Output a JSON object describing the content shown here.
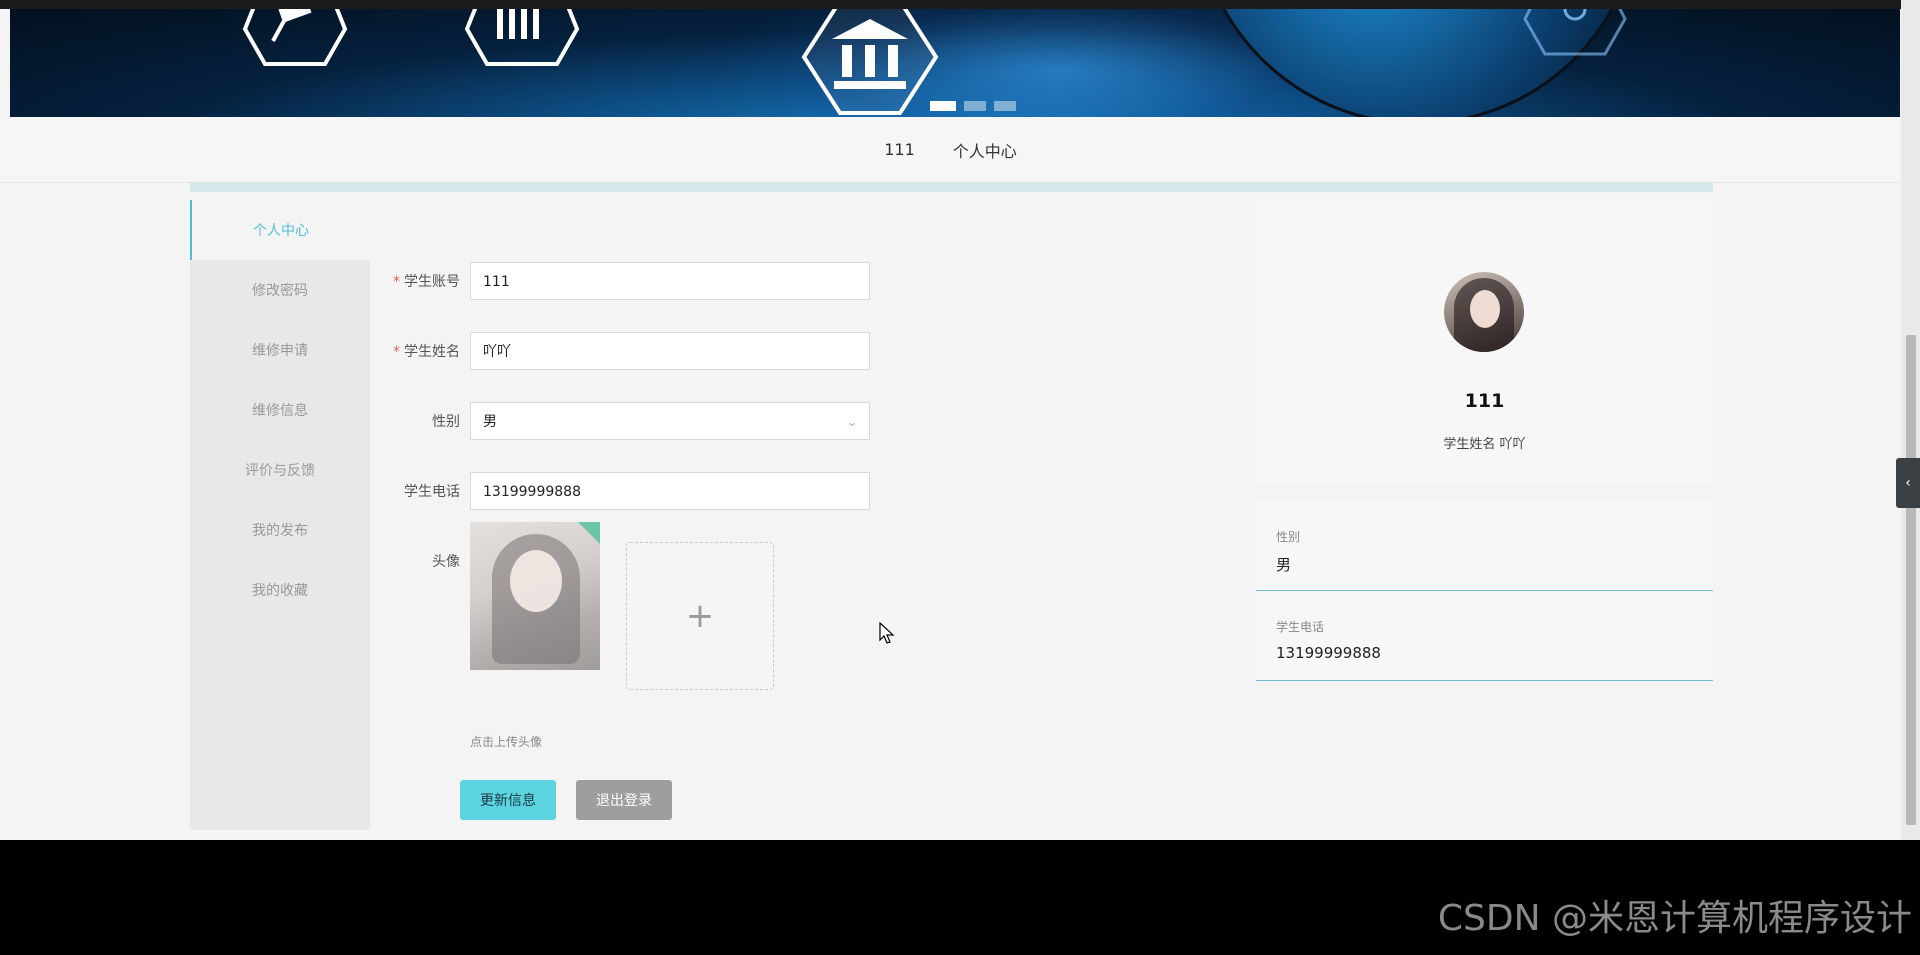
{
  "nav": {
    "items": [
      "111",
      "个人中心"
    ]
  },
  "menu": {
    "items": [
      "个人中心",
      "修改密码",
      "维修申请",
      "维修信息",
      "评价与反馈",
      "我的发布",
      "我的收藏"
    ],
    "active_index": 0
  },
  "form": {
    "account": {
      "label": "学生账号",
      "value": "111",
      "required": true
    },
    "name": {
      "label": "学生姓名",
      "value": "吖吖",
      "required": true
    },
    "gender": {
      "label": "性别",
      "value": "男"
    },
    "phone": {
      "label": "学生电话",
      "value": "13199999888"
    },
    "avatar": {
      "label": "头像",
      "hint": "点击上传头像"
    },
    "update_button": "更新信息",
    "logout_button": "退出登录",
    "required_mark": "*"
  },
  "profile": {
    "title": "111",
    "subtitle": "学生姓名 吖吖",
    "gender_label": "性别",
    "gender_value": "男",
    "phone_label": "学生电话",
    "phone_value": "13199999888"
  },
  "banner": {
    "slides": 3,
    "active_slide": 0
  },
  "side_toggle_icon": "chevron-left-icon",
  "watermark": "CSDN @米恩计算机程序设计",
  "colors": {
    "accent": "#4ec0d6",
    "primary_button": "#5cd3e1",
    "secondary_button": "#9e9e9e",
    "required": "#e05c5c"
  }
}
